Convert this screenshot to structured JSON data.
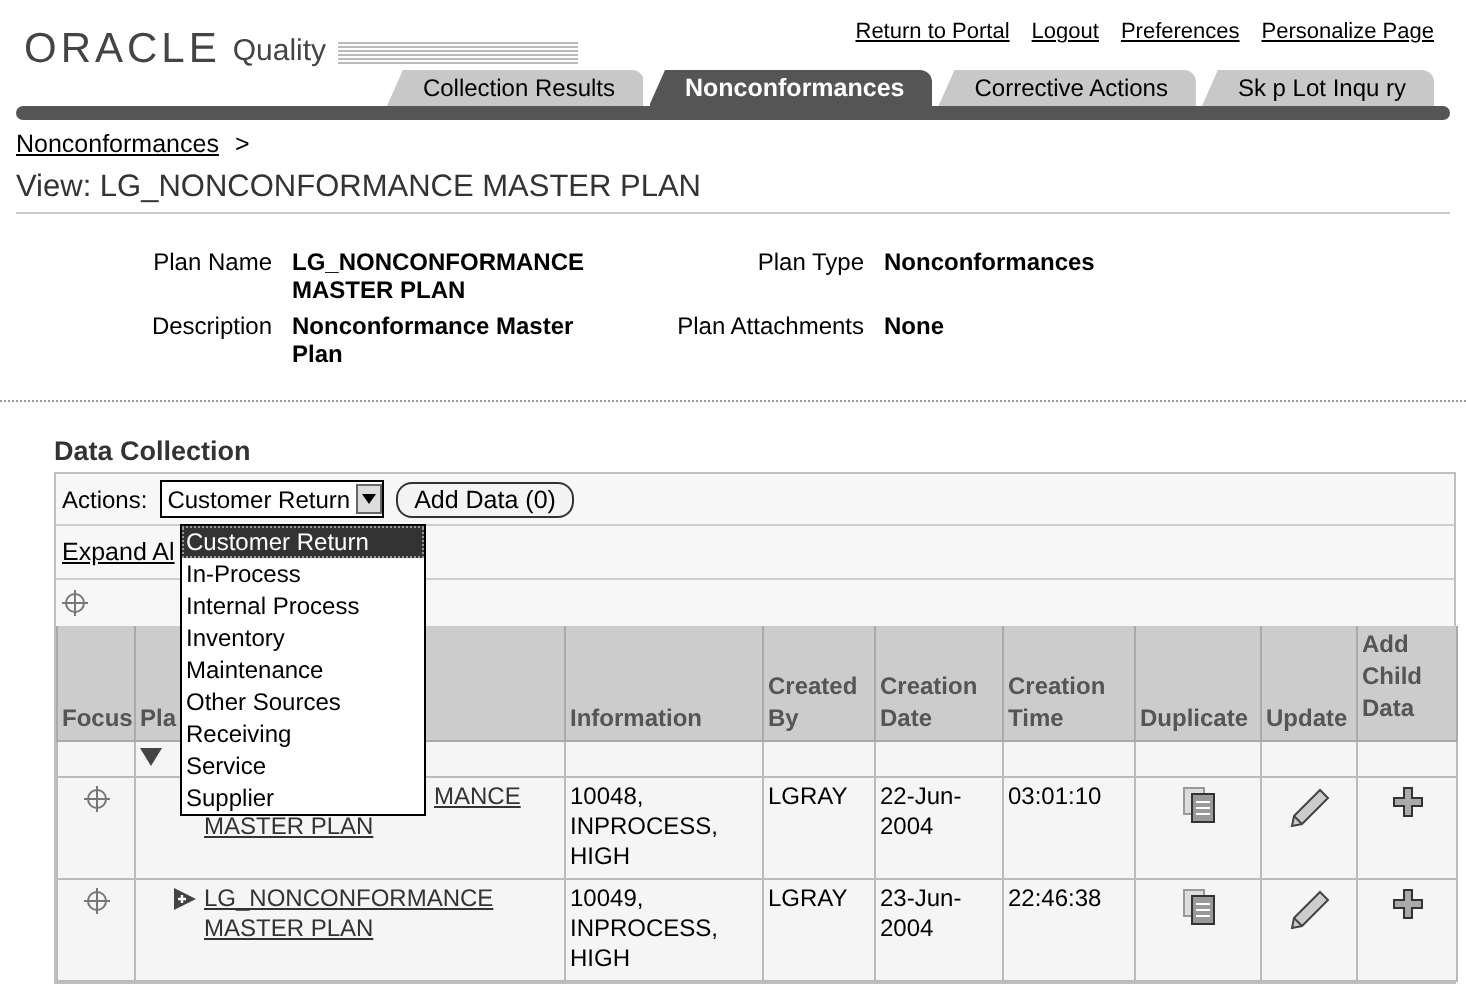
{
  "header": {
    "logo": "ORACLE",
    "product": "Quality",
    "links": [
      "Return to Portal",
      "Logout",
      "Preferences",
      "Personalize Page"
    ]
  },
  "tabs": [
    {
      "label": "Collection Results",
      "selected": false
    },
    {
      "label": "Nonconformances",
      "selected": true
    },
    {
      "label": "Corrective Actions",
      "selected": false
    },
    {
      "label": "Sk p Lot Inqu ry",
      "selected": false
    }
  ],
  "breadcrumb": {
    "link": "Nonconformances",
    "separator": ">"
  },
  "title": "View: LG_NONCONFORMANCE MASTER PLAN",
  "details": [
    {
      "label": "Plan Name",
      "value": "LG_NONCONFORMANCE MASTER PLAN"
    },
    {
      "label": "Plan Type",
      "value": "Nonconformances"
    },
    {
      "label": "Description",
      "value": "Nonconformance Master Plan"
    },
    {
      "label": "Plan Attachments",
      "value": "None"
    }
  ],
  "data_collection": {
    "heading": "Data Collection",
    "actions_label": "Actions:",
    "select_value": "Customer Return",
    "add_button": "Add Data (0)",
    "expand_link": "Expand Al",
    "columns": [
      "Focus",
      "Pla",
      "Information",
      "Created By",
      "Creation Date",
      "Creation Time",
      "Duplicate",
      "Update",
      "Add Child Data"
    ],
    "tree_row": {
      "expanded": true
    },
    "rows": [
      {
        "expand_icon": false,
        "plan_lines": [
          "MANCE",
          "MASTER PLAN"
        ],
        "information": "10048, INPROCESS, HIGH",
        "created_by": "LGRAY",
        "creation_date": "22-Jun-2004",
        "creation_time": "03:01:10"
      },
      {
        "expand_icon": true,
        "plan_lines": [
          "LG_NONCONFORMANCE",
          "MASTER PLAN"
        ],
        "information": "10049, INPROCESS, HIGH",
        "created_by": "LGRAY",
        "creation_date": "23-Jun-2004",
        "creation_time": "22:46:38"
      }
    ],
    "dropdown": [
      {
        "label": "Customer Return",
        "selected": true
      },
      {
        "label": "In-Process",
        "selected": false
      },
      {
        "label": "Internal Process",
        "selected": false
      },
      {
        "label": "Inventory",
        "selected": false
      },
      {
        "label": "Maintenance",
        "selected": false
      },
      {
        "label": "Other Sources",
        "selected": false
      },
      {
        "label": "Receiving",
        "selected": false
      },
      {
        "label": "Service",
        "selected": false
      },
      {
        "label": "Supplier",
        "selected": false
      }
    ]
  }
}
